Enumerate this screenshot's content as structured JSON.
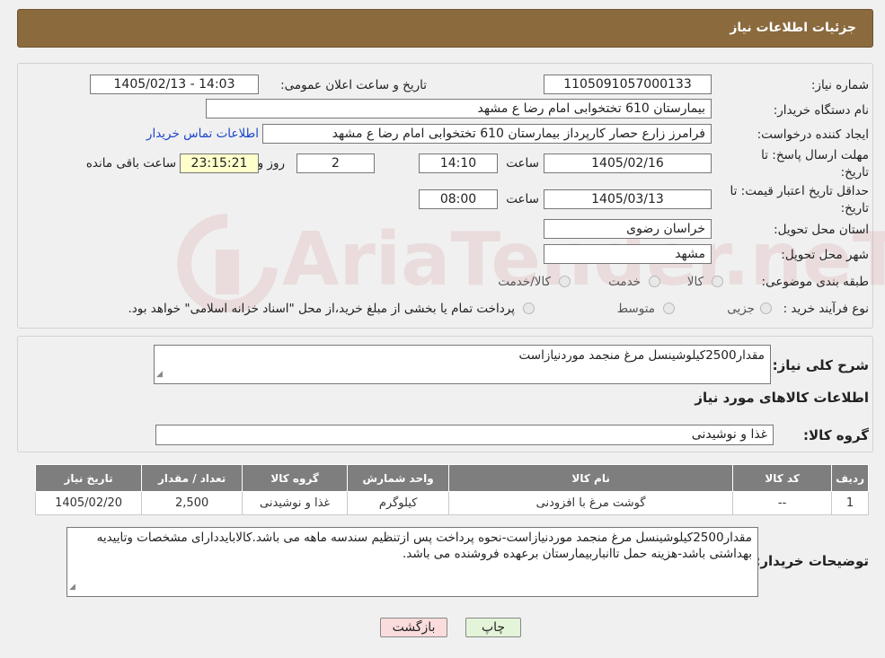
{
  "header": {
    "title": "جزئیات اطلاعات نیاز"
  },
  "watermark": {
    "text": "AriaTender.neT"
  },
  "form": {
    "need_number_label": "شماره نیاز:",
    "need_number": "1105091057000133",
    "announce_label": "تاریخ و ساعت اعلان عمومی:",
    "announce_value": "1405/02/13 - 14:03",
    "buyer_org_label": "نام دستگاه خریدار:",
    "buyer_org": "بیمارستان 610 تختخوابی امام رضا ع  مشهد",
    "creator_label": "ایجاد کننده درخواست:",
    "creator": "فرامرز زارع حصار کارپرداز بیمارستان 610 تختخوابی امام رضا ع  مشهد",
    "contact_link": "اطلاعات تماس خریدار",
    "deadline_label_1": "مهلت ارسال پاسخ: تا",
    "deadline_label_2": "تاریخ:",
    "deadline_date": "1405/02/16",
    "time_label": "ساعت",
    "deadline_time": "14:10",
    "days_value": "2",
    "days_label": "روز و",
    "remaining_time": "23:15:21",
    "remaining_label": "ساعت باقی مانده",
    "validity_label_1": "حداقل تاریخ اعتبار قیمت: تا",
    "validity_label_2": "تاریخ:",
    "validity_date": "1405/03/13",
    "validity_time": "08:00",
    "province_label": "استان محل تحویل:",
    "province": "خراسان رضوی",
    "city_label": "شهر محل تحویل:",
    "city": "مشهد",
    "category_label": "طبقه بندی موضوعی:",
    "category_options": [
      "کالا",
      "خدمت",
      "کالا/خدمت"
    ],
    "process_label": "نوع فرآیند خرید :",
    "process_options": [
      "جزیی",
      "متوسط"
    ],
    "process_note": "پرداخت تمام یا بخشی از مبلغ خرید،از محل \"اسناد خزانه اسلامی\" خواهد بود."
  },
  "summary": {
    "desc_label": "شرح کلی نیاز:",
    "desc": "مقدار2500کیلوشینسل مرغ منجمد موردنیازاست",
    "goods_title": "اطلاعات کالاهای مورد نیاز",
    "group_label": "گروه کالا:",
    "group": "غذا و نوشیدنی"
  },
  "table": {
    "headers": [
      "ردیف",
      "کد کالا",
      "نام کالا",
      "واحد شمارش",
      "گروه کالا",
      "تعداد / مقدار",
      "تاریخ نیاز"
    ],
    "rows": [
      [
        "1",
        "--",
        "گوشت مرغ با افزودنی",
        "کیلوگرم",
        "غذا و نوشیدنی",
        "2,500",
        "1405/02/20"
      ]
    ]
  },
  "buyer_notes": {
    "label": "توضیحات خریدار:",
    "text": "مقدار2500کیلوشینسل مرغ منجمد موردنیازاست-نحوه پرداخت پس ازتنظیم سندسه ماهه می باشد.کالابایددارای مشخصات وتاییدیه بهداشتی باشد-هزینه حمل تاانباربیمارستان برعهده فروشنده می باشد."
  },
  "buttons": {
    "print": "چاپ",
    "back": "بازگشت"
  },
  "colors": {
    "header_bg": "#8b6a3e",
    "back_btn_bg": "#fbdcdc",
    "print_btn_bg": "#e4f4d8",
    "yellow_box": "#ffffcc"
  }
}
